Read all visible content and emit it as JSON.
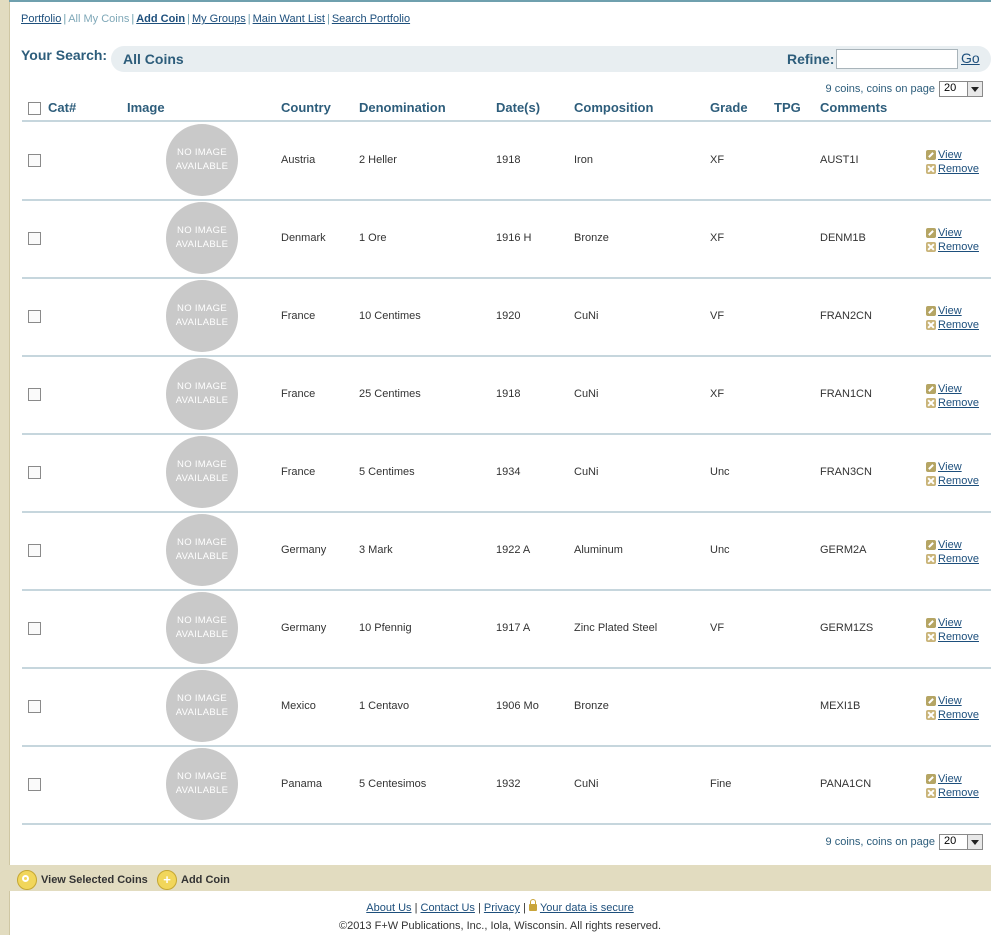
{
  "nav": {
    "items": [
      {
        "label": "Portfolio",
        "state": "link"
      },
      {
        "label": "All My Coins",
        "state": "current"
      },
      {
        "label": "Add Coin",
        "state": "bold"
      },
      {
        "label": "My Groups",
        "state": "link"
      },
      {
        "label": "Main Want List",
        "state": "link"
      },
      {
        "label": "Search Portfolio",
        "state": "link"
      }
    ]
  },
  "search": {
    "label": "Your Search:",
    "value": "All Coins",
    "refine_label": "Refine:",
    "refine_value": "",
    "go_label": "Go"
  },
  "pager": {
    "text": "9 coins, coins on page",
    "page_size": "20"
  },
  "table": {
    "headers": [
      "Cat#",
      "Image",
      "Country",
      "Denomination",
      "Date(s)",
      "Composition",
      "Grade",
      "TPG",
      "Comments"
    ],
    "no_image_line1": "NO IMAGE",
    "no_image_line2": "AVAILABLE",
    "view_label": "View",
    "remove_label": "Remove",
    "rows": [
      {
        "country": "Austria",
        "denomination": "2 Heller",
        "date": "1918",
        "composition": "Iron",
        "grade": "XF",
        "tpg": "",
        "comments": "AUST1I"
      },
      {
        "country": "Denmark",
        "denomination": "1 Ore",
        "date": "1916 H",
        "composition": "Bronze",
        "grade": "XF",
        "tpg": "",
        "comments": "DENM1B"
      },
      {
        "country": "France",
        "denomination": "10 Centimes",
        "date": "1920",
        "composition": "CuNi",
        "grade": "VF",
        "tpg": "",
        "comments": "FRAN2CN"
      },
      {
        "country": "France",
        "denomination": "25 Centimes",
        "date": "1918",
        "composition": "CuNi",
        "grade": "XF",
        "tpg": "",
        "comments": "FRAN1CN"
      },
      {
        "country": "France",
        "denomination": "5 Centimes",
        "date": "1934",
        "composition": "CuNi",
        "grade": "Unc",
        "tpg": "",
        "comments": "FRAN3CN"
      },
      {
        "country": "Germany",
        "denomination": "3 Mark",
        "date": "1922 A",
        "composition": "Aluminum",
        "grade": "Unc",
        "tpg": "",
        "comments": "GERM2A"
      },
      {
        "country": "Germany",
        "denomination": "10 Pfennig",
        "date": "1917 A",
        "composition": "Zinc Plated Steel",
        "grade": "VF",
        "tpg": "",
        "comments": "GERM1ZS"
      },
      {
        "country": "Mexico",
        "denomination": "1 Centavo",
        "date": "1906 Mo",
        "composition": "Bronze",
        "grade": "",
        "tpg": "",
        "comments": "MEXI1B"
      },
      {
        "country": "Panama",
        "denomination": "5 Centesimos",
        "date": "1932",
        "composition": "CuNi",
        "grade": "Fine",
        "tpg": "",
        "comments": "PANA1CN"
      }
    ]
  },
  "footerbar": {
    "view_selected_label": "View Selected Coins",
    "add_coin_label": "Add Coin"
  },
  "footer": {
    "about": "About Us",
    "contact": "Contact Us",
    "privacy": "Privacy",
    "secure": "Your data is secure",
    "copyright": "©2013 F+W Publications, Inc., Iola, Wisconsin. All rights reserved."
  },
  "colors": {
    "accent": "#2d5d7b",
    "link": "#1d4f7c",
    "divider": "#c6d6dd",
    "sidebar": "#e2dcc0"
  }
}
